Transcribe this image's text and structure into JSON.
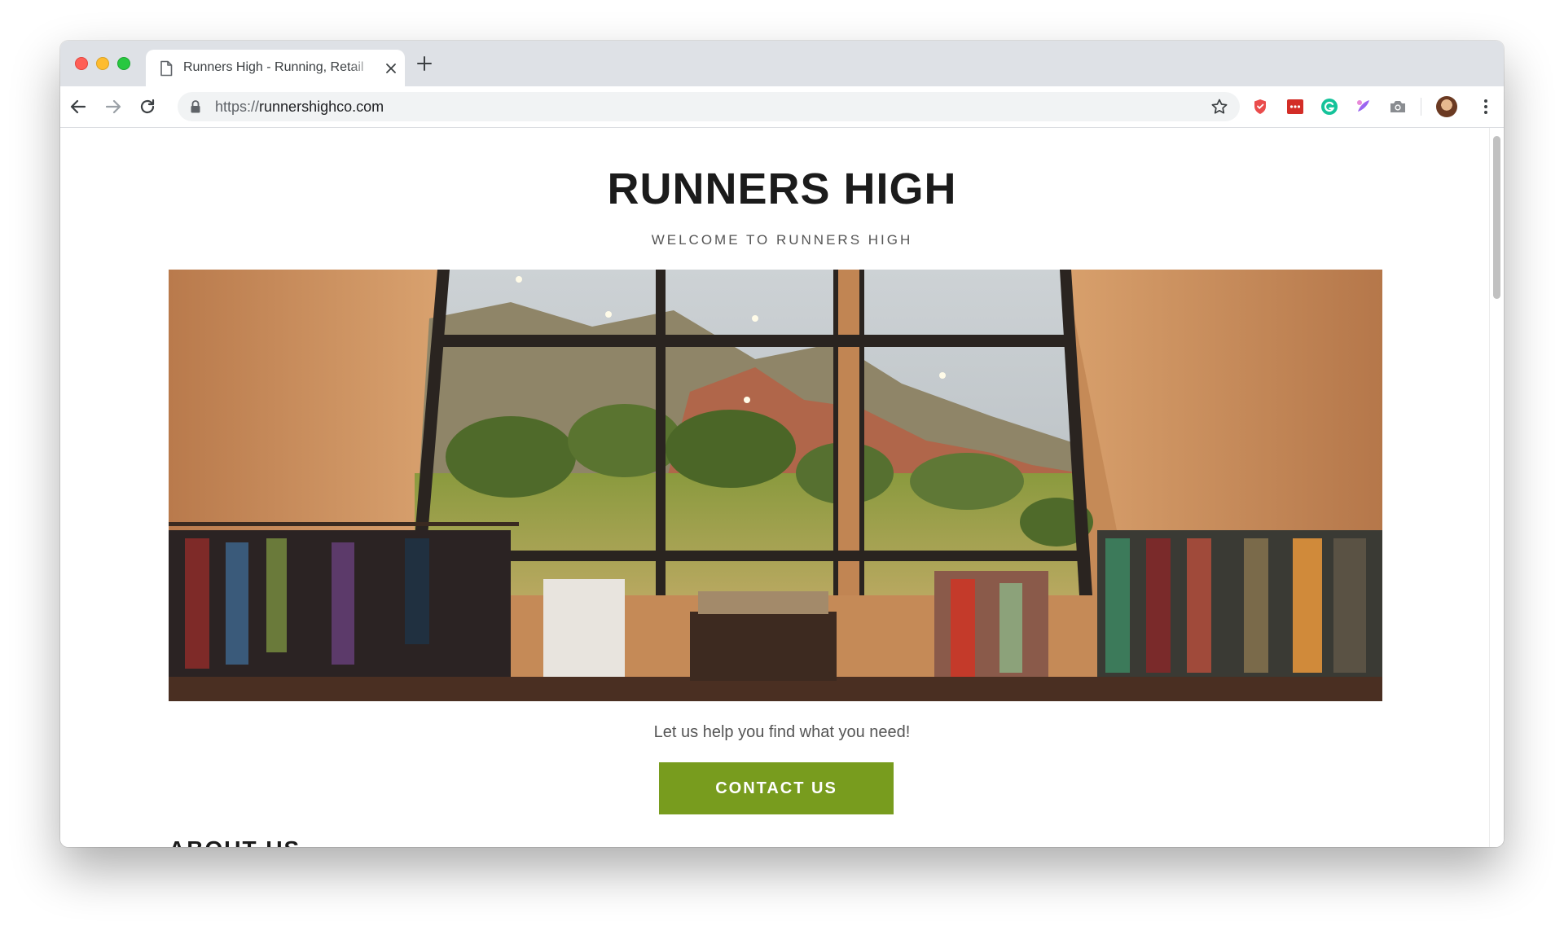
{
  "browser": {
    "tab_title": "Runners High - Running, Retail",
    "url_scheme": "https://",
    "url_host": "runnershighco.com",
    "icons": [
      "doc-icon",
      "close-icon",
      "plus-icon",
      "back-arrow-icon",
      "forward-arrow-icon",
      "reload-icon",
      "lock-icon",
      "star-icon",
      "shield-extension-icon",
      "lastpass-extension-icon",
      "grammarly-extension-icon",
      "color-extension-icon",
      "camera-extension-icon",
      "profile-avatar",
      "kebab-menu-icon"
    ]
  },
  "site": {
    "title": "RUNNERS HIGH",
    "tagline": "WELCOME TO RUNNERS HIGH",
    "hero_image": "store-interior-photo",
    "intro": "Let us help you find what you need!",
    "cta_label": "CONTACT US",
    "section_heading": "ABOUT US"
  },
  "colors": {
    "cta": "#789c1e",
    "tabstrip": "#dee1e6",
    "title": "#1b1b1b"
  }
}
